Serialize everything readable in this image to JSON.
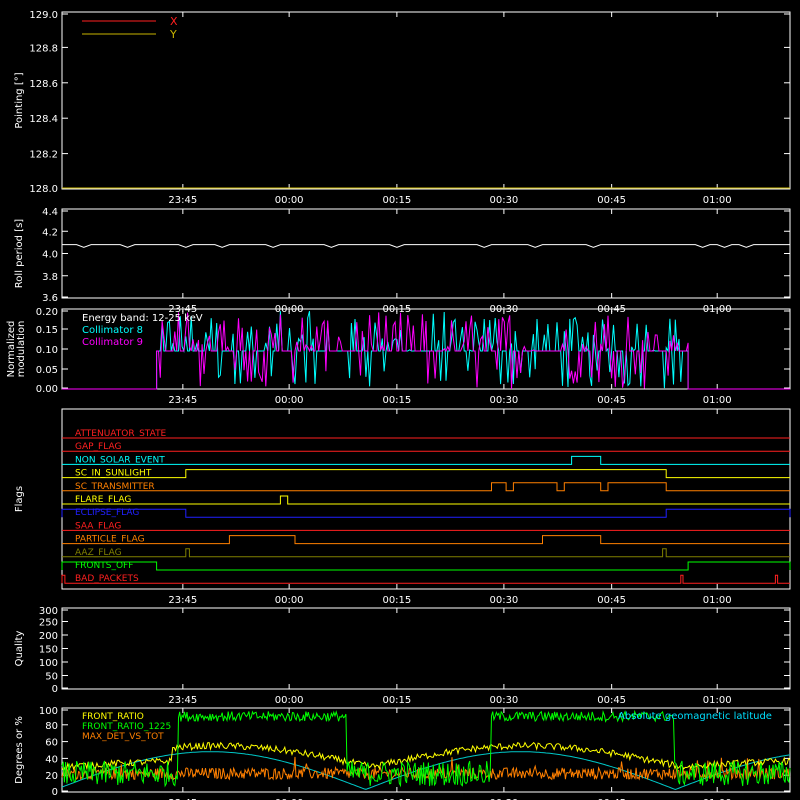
{
  "time_ticks": [
    "23:45",
    "00:00",
    "00:15",
    "00:30",
    "00:45",
    "01:00"
  ],
  "chart_data": [
    {
      "type": "line",
      "ylabel": "Pointing [°]",
      "ylim": [
        128.0,
        129.0
      ],
      "yticks": [
        "129.0",
        "128.8",
        "128.6",
        "128.4",
        "128.2",
        "128.0"
      ],
      "legend_placement": "top-left",
      "legend": [
        {
          "name": "X",
          "color": "#ff2020"
        },
        {
          "name": "Y",
          "color": "#c8b400"
        }
      ],
      "series": [
        {
          "name": "Y",
          "color": "#c8b400",
          "constant": 128.0
        }
      ]
    },
    {
      "type": "line",
      "ylabel": "Roll period [s]",
      "ylim": [
        3.5,
        4.5
      ],
      "yticks": [
        "4.4",
        "4.2",
        "4.0",
        "3.8",
        "3.6"
      ],
      "series": [
        {
          "name": "roll",
          "color": "#ffffff",
          "baseline": 4.1,
          "dips": [
            3,
            9,
            17,
            22,
            29,
            37,
            46,
            58,
            65,
            73,
            88,
            91,
            94
          ]
        }
      ]
    },
    {
      "type": "line",
      "ylabel": "Normalized modulation",
      "ylim": [
        0,
        0.2
      ],
      "yticks": [
        "0.20",
        "0.15",
        "0.10",
        "0.05",
        "0.00"
      ],
      "annotation": "Energy band: 12-25 keV",
      "legend": [
        {
          "name": "Collimator 8",
          "color": "#00ffff"
        },
        {
          "name": "Collimator 9",
          "color": "#ff00ff"
        }
      ],
      "active_range_fraction": [
        0.13,
        0.86
      ],
      "series": [
        {
          "name": "Collimator 8",
          "color": "#00ffff",
          "base": 0.095
        },
        {
          "name": "Collimator 9",
          "color": "#ff00ff",
          "base": 0.095
        }
      ]
    },
    {
      "type": "line",
      "ylabel": "Flags",
      "flags": [
        {
          "name": "ATTENUATOR_STATE",
          "color": "#ff2020",
          "segments": []
        },
        {
          "name": "GAP_FLAG",
          "color": "#ff2020",
          "segments": []
        },
        {
          "name": "NON_SOLAR_EVENT",
          "color": "#00ffff",
          "segments": [
            [
              0.7,
              0.74
            ]
          ]
        },
        {
          "name": "SC_IN_SUNLIGHT",
          "color": "#ffff00",
          "segments": [
            [
              0.17,
              0.83
            ]
          ]
        },
        {
          "name": "SC_TRANSMITTER",
          "color": "#ff8000",
          "segments": [
            [
              0.59,
              0.61
            ],
            [
              0.62,
              0.68
            ],
            [
              0.69,
              0.74
            ],
            [
              0.75,
              0.83
            ]
          ]
        },
        {
          "name": "FLARE_FLAG",
          "color": "#ffff00",
          "segments": [
            [
              0.3,
              0.31
            ]
          ]
        },
        {
          "name": "ECLIPSE_FLAG",
          "color": "#2020ff",
          "segments": [
            [
              0.0,
              0.17
            ],
            [
              0.83,
              1.0
            ]
          ]
        },
        {
          "name": "SAA_FLAG",
          "color": "#ff2020",
          "segments": []
        },
        {
          "name": "PARTICLE_FLAG",
          "color": "#ff8000",
          "segments": [
            [
              0.23,
              0.32
            ],
            [
              0.66,
              0.74
            ]
          ]
        },
        {
          "name": "AAZ_FLAG",
          "color": "#808000",
          "segments": [
            [
              0.17,
              0.175
            ],
            [
              0.825,
              0.83
            ]
          ]
        },
        {
          "name": "FRONTS_OFF",
          "color": "#00ff00",
          "segments": [
            [
              0.0,
              0.13
            ],
            [
              0.86,
              1.0
            ]
          ]
        },
        {
          "name": "BAD_PACKETS",
          "color": "#ff2020",
          "segments": [
            [
              0.0,
              0.004
            ],
            [
              0.85,
              0.853
            ],
            [
              0.98,
              0.983
            ]
          ]
        }
      ]
    },
    {
      "type": "line",
      "ylabel": "Quality",
      "ylim": [
        0,
        300
      ],
      "yticks": [
        "300",
        "250",
        "200",
        "150",
        "100",
        "50",
        "0"
      ],
      "series": []
    },
    {
      "type": "line",
      "ylabel": "Degrees or %",
      "ylim": [
        0,
        100
      ],
      "yticks": [
        "100",
        "80",
        "60",
        "40",
        "20",
        "0"
      ],
      "legend": [
        {
          "name": "FRONT_RATIO",
          "color": "#ffff00"
        },
        {
          "name": "FRONT_RATIO_1225",
          "color": "#00ff00"
        },
        {
          "name": "MAX_DET_VS_TOT",
          "color": "#ff8000"
        }
      ],
      "right_label": "Absolute geomagnetic latitude",
      "right_label_color": "#00e0ff",
      "series": [
        {
          "name": "FRONT_RATIO_1225",
          "color": "#00ff00",
          "active_ranges": [
            [
              0.16,
              0.39
            ],
            [
              0.59,
              0.84
            ]
          ],
          "level": 90
        },
        {
          "name": "FRONT_RATIO",
          "color": "#ffff00",
          "base": 30
        },
        {
          "name": "MAX_DET_VS_TOT",
          "color": "#ff8000",
          "base": 22
        },
        {
          "name": "Absolute geomagnetic latitude",
          "color": "#00c8c8",
          "amplitude": 45
        }
      ]
    }
  ]
}
